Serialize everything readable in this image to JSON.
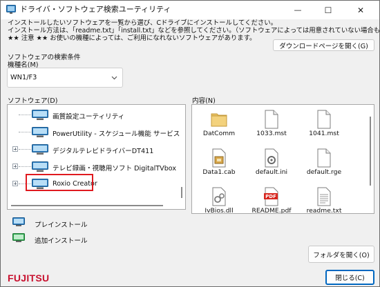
{
  "window": {
    "title": "ドライバ・ソフトウェア検索ユーティリティ",
    "controls": {
      "minimize": "—",
      "maximize": "☐",
      "close": "✕"
    }
  },
  "instructions": [
    "インストールしたいソフトウェアを一覧から選び、Cドライブにインストールしてください。",
    "インストール方法は、「readme.txt」「install.txt」などを参照してください。（ソフトウェアによっては用意されていない場合もあります）",
    "★★ 注意 ★★ お使いの機種によっては、ご利用になれないソフトウェアがあります。"
  ],
  "download_button": "ダウンロードページを開く(G)",
  "search": {
    "section_label": "ソフトウェアの検索条件",
    "model_label": "機種名(M)",
    "model_value": "WN1/F3"
  },
  "software": {
    "label": "ソフトウェア(D)",
    "items": [
      {
        "label": "画質設定ユーティリティ",
        "expandable": false
      },
      {
        "label": "PowerUtility - スケジュール機能 サービス",
        "expandable": false
      },
      {
        "label": "デジタルテレビドライバーDT411",
        "expandable": true
      },
      {
        "label": "テレビ録画・視聴用ソフト DigitalTVbox",
        "expandable": true
      },
      {
        "label": "Roxio Creator",
        "expandable": true,
        "selected": true
      }
    ]
  },
  "contents": {
    "label": "内容(N)",
    "files": [
      {
        "name": "DatComm",
        "icon": "folder-icon"
      },
      {
        "name": "1033.mst",
        "icon": "file-icon"
      },
      {
        "name": "1041.mst",
        "icon": "file-icon"
      },
      {
        "name": "Data1.cab",
        "icon": "installer-icon"
      },
      {
        "name": "default.ini",
        "icon": "settings-file-icon"
      },
      {
        "name": "default.rge",
        "icon": "file-icon"
      },
      {
        "name": "IvBios.dll",
        "icon": "dll-file-icon"
      },
      {
        "name": "README.pdf",
        "icon": "pdf-icon"
      },
      {
        "name": "readme.txt",
        "icon": "text-file-icon"
      }
    ]
  },
  "pdf_badge": "PDF",
  "legend": {
    "preinstall": "プレインストール",
    "additional": "追加インストール"
  },
  "open_folder_button": "フォルダを開く(O)",
  "close_button": "閉じる(C)",
  "brand": "FUJITSU",
  "colors": {
    "accent_red": "#e0191f",
    "brand_red": "#c8102e",
    "folder": "#e8c063",
    "preinstall_icon": "#2f7fc1",
    "additional_icon": "#2fa84f"
  }
}
